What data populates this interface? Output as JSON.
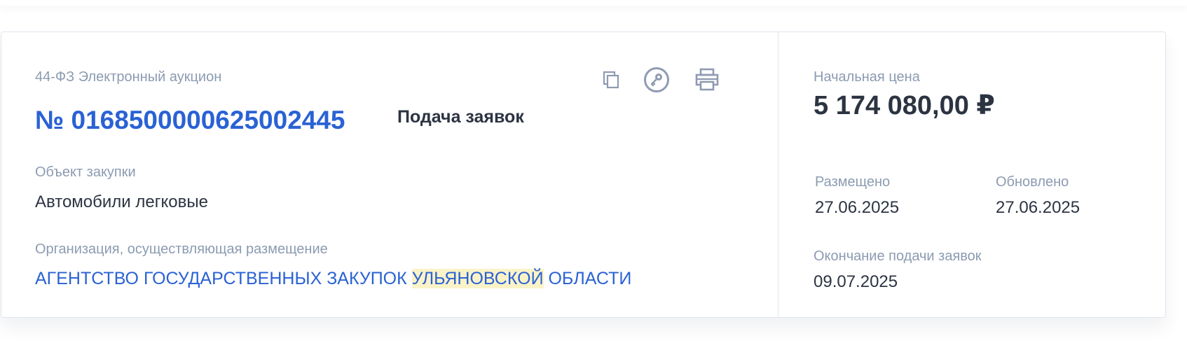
{
  "procurement": {
    "type": "44-ФЗ Электронный аукцион",
    "number": "№ 0168500000625002445",
    "status": "Подача заявок",
    "object_label": "Объект закупки",
    "object_value": "Автомобили легковые",
    "org_label": "Организация, осуществляющая размещение",
    "org_name_before": "АГЕНТСТВО ГОСУДАРСТВЕННЫХ ЗАКУПОК ",
    "org_name_highlight": "УЛЬЯНОВСКОЙ",
    "org_name_after": " ОБЛАСТИ"
  },
  "actions": {
    "copy_icon": "copy-icon",
    "key_icon": "key-icon",
    "print_icon": "printer-icon"
  },
  "summary": {
    "price_label": "Начальная цена",
    "price_value": "5 174 080,00 ₽",
    "posted_label": "Размещено",
    "posted_value": "27.06.2025",
    "updated_label": "Обновлено",
    "updated_value": "27.06.2025",
    "deadline_label": "Окончание подачи заявок",
    "deadline_value": "09.07.2025"
  },
  "colors": {
    "link": "#2a62d4",
    "muted": "#8c9bb1",
    "text": "#2c3442",
    "icon": "#8f9bb2",
    "highlight": "#fbf3c8"
  }
}
